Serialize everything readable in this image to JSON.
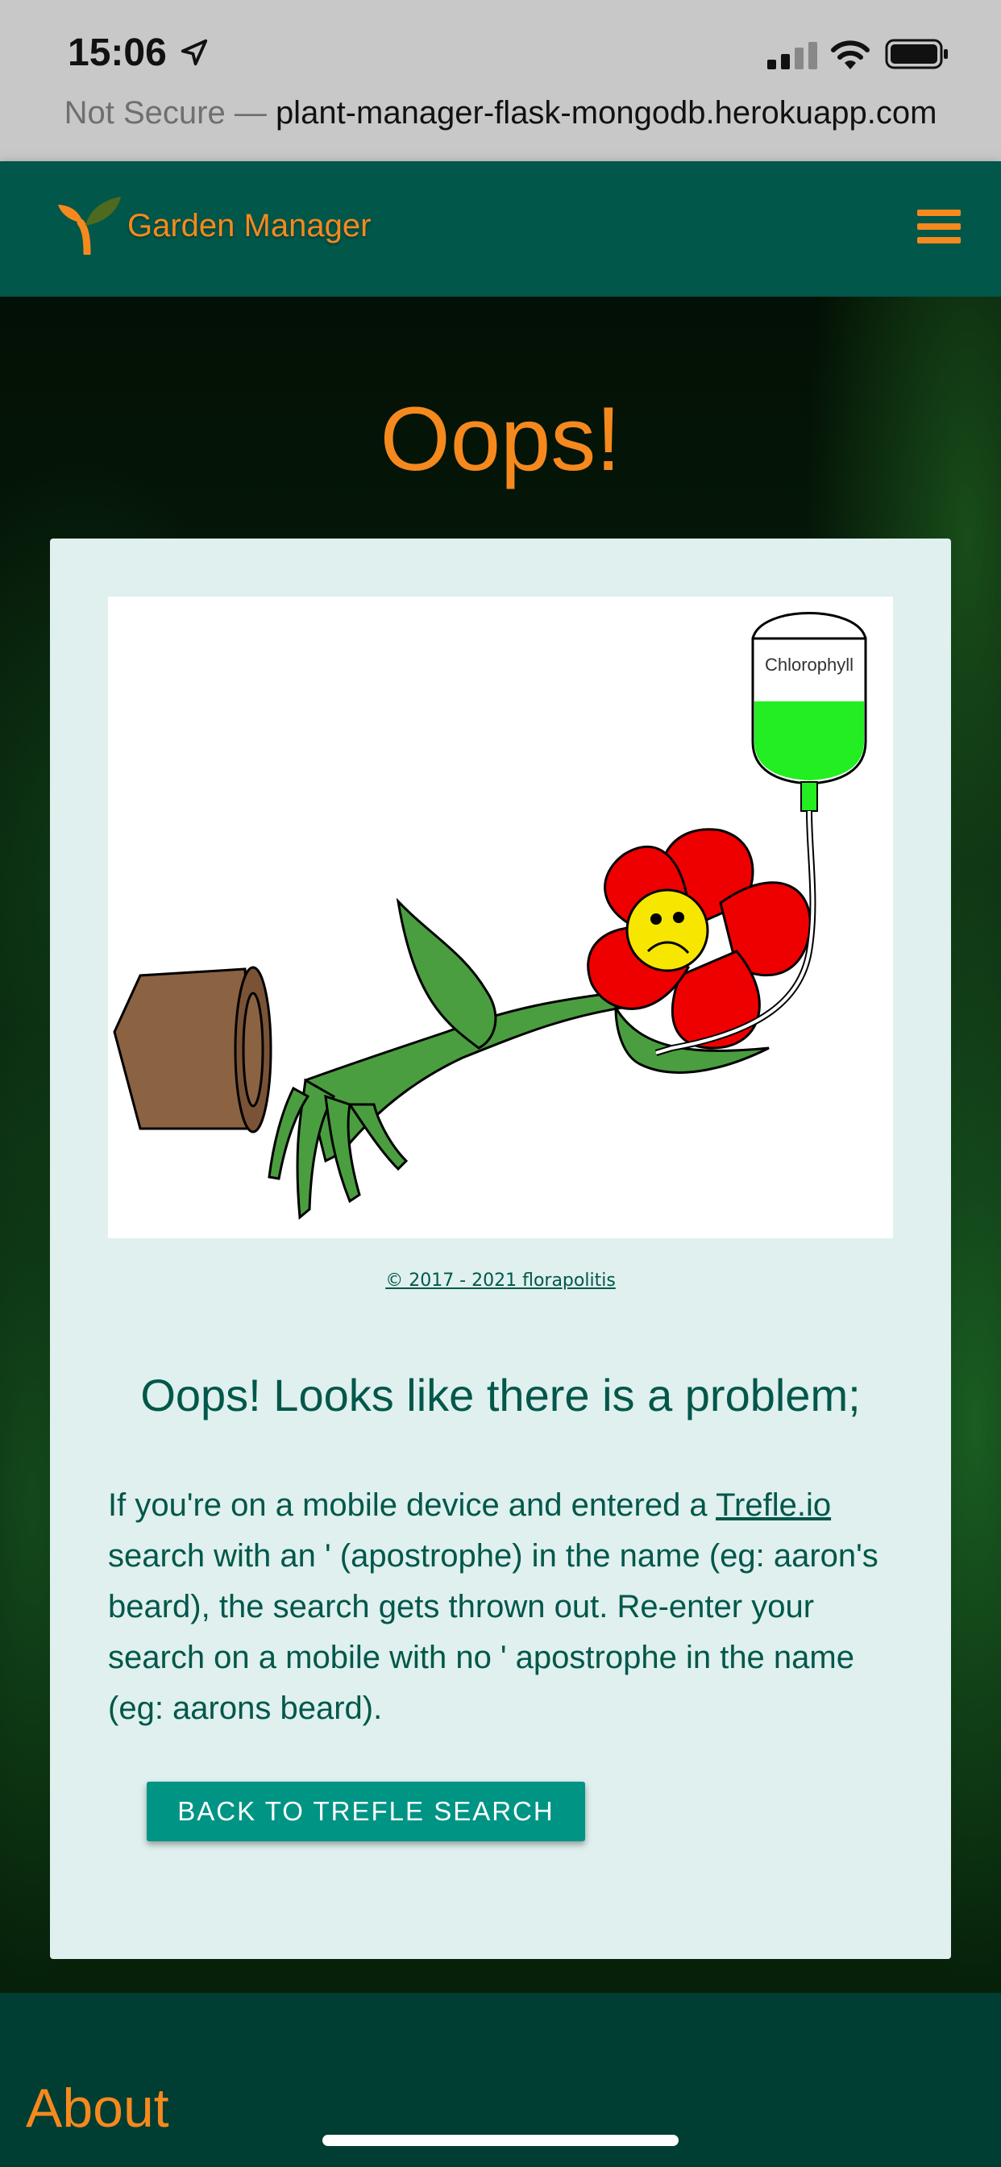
{
  "status_bar": {
    "time": "15:06"
  },
  "url_bar": {
    "prefix": "Not Secure — ",
    "domain": "plant-manager-flask-mongodb.herokuapp.com"
  },
  "nav": {
    "brand": "Garden Manager"
  },
  "page": {
    "heading": "Oops!"
  },
  "card": {
    "illustration_label": "Chlorophyll",
    "copyright": "© 2017 - 2021 florapolitis",
    "subheading": "Oops! Looks like there is a problem;",
    "body_link": "Trefle.io",
    "body_before": "If you're on a mobile device and entered a ",
    "body_after": " search with an ' (apostrophe) in the name (eg: aaron's beard), the search gets thrown out. Re-enter your search on a mobile with no ' apostrophe in the name (eg: aarons beard).",
    "button_label": "BACK TO TREFLE SEARCH"
  },
  "footer": {
    "about": "About"
  },
  "colors": {
    "nav": "#00574a",
    "accent": "#f5891e",
    "card": "#dff0ee",
    "button": "#009485",
    "footer": "#003d33"
  }
}
